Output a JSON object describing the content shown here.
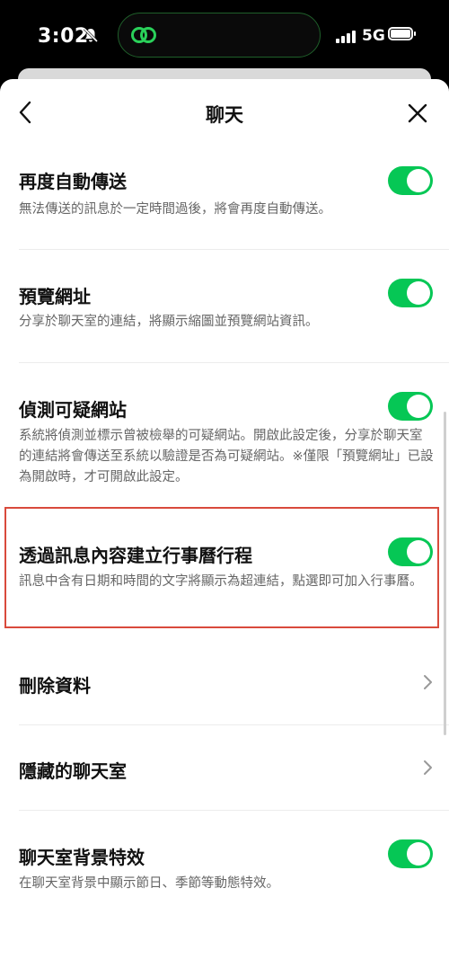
{
  "status_bar": {
    "time": "3:02",
    "network": "5G"
  },
  "nav": {
    "title": "聊天"
  },
  "settings": [
    {
      "title": "再度自動傳送",
      "desc": "無法傳送的訊息於一定時間過後，將會再度自動傳送。",
      "control": "toggle",
      "on": true
    },
    {
      "title": "預覽網址",
      "desc": "分享於聊天室的連結，將顯示縮圖並預覽網站資訊。",
      "control": "toggle",
      "on": true
    },
    {
      "title": "偵測可疑網站",
      "desc": "系統將偵測並標示曾被檢舉的可疑網站。開啟此設定後，分享於聊天室的連結將會傳送至系統以驗證是否為可疑網站。※僅限「預覽網址」已設為開啟時，才可開啟此設定。",
      "control": "toggle",
      "on": true
    },
    {
      "title": "透過訊息內容建立行事曆行程",
      "desc": "訊息中含有日期和時間的文字將顯示為超連結，點選即可加入行事曆。",
      "control": "toggle",
      "on": true
    },
    {
      "title": "刪除資料",
      "control": "chevron"
    },
    {
      "title": "隱藏的聊天室",
      "control": "chevron"
    },
    {
      "title": "聊天室背景特效",
      "desc": "在聊天室背景中顯示節日、季節等動態特效。",
      "control": "toggle",
      "on": true
    }
  ],
  "colors": {
    "toggle_on": "#06c755",
    "highlight_border": "#d94a3c"
  }
}
